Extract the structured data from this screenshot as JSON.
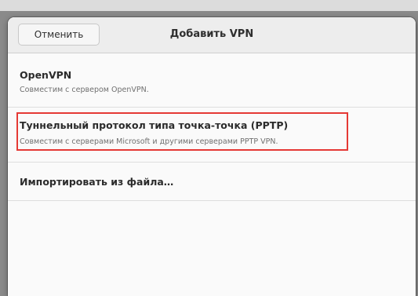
{
  "dialog": {
    "title": "Добавить VPN",
    "cancel_label": "Отменить"
  },
  "vpn_types": [
    {
      "title": "OpenVPN",
      "subtitle": "Совместим с сервером OpenVPN."
    },
    {
      "title": "Туннельный протокол типа точка-точка (PPTP)",
      "subtitle": "Совместим с серверами Microsoft и другими серверами PPTP VPN.",
      "highlighted": true
    },
    {
      "title": "Импортировать из файла…"
    }
  ],
  "colors": {
    "highlight": "#e53935",
    "dialog_bg": "#fafafa",
    "header_bg": "#ededed"
  }
}
